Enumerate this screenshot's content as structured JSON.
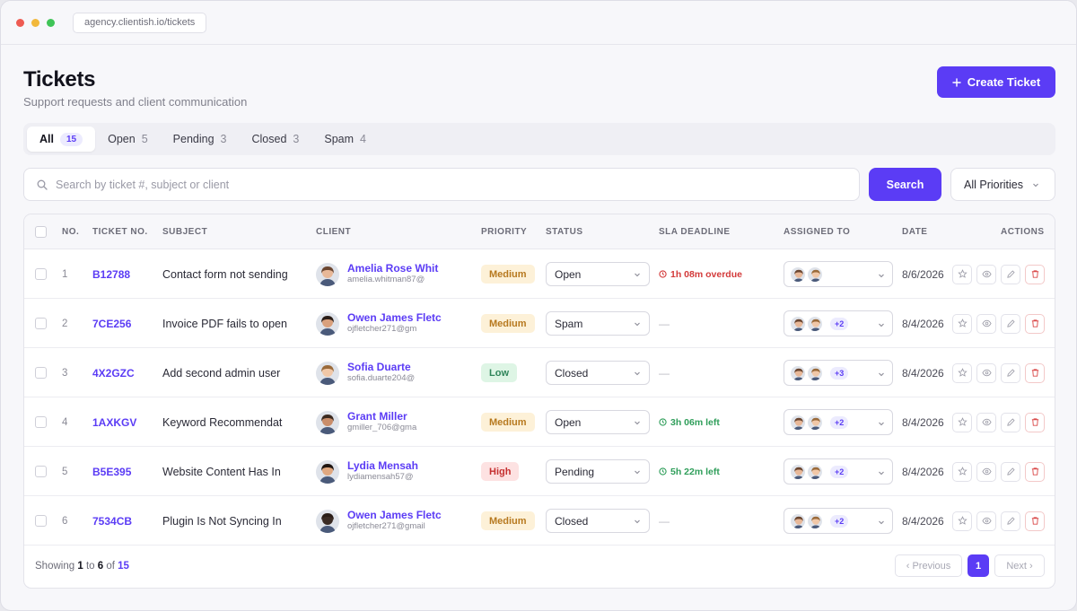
{
  "browser": {
    "url": "agency.clientish.io/tickets"
  },
  "header": {
    "title": "Tickets",
    "subtitle": "Support requests and client communication",
    "create_label": "Create Ticket"
  },
  "tabs": [
    {
      "label": "All",
      "count": "15",
      "active": true
    },
    {
      "label": "Open",
      "count": "5"
    },
    {
      "label": "Pending",
      "count": "3"
    },
    {
      "label": "Closed",
      "count": "3"
    },
    {
      "label": "Spam",
      "count": "4"
    }
  ],
  "search": {
    "placeholder": "Search by ticket #, subject or client",
    "value": "",
    "button_label": "Search",
    "priority_filter": "All Priorities"
  },
  "table": {
    "columns": {
      "no": "NO.",
      "ticket": "TICKET NO.",
      "subject": "SUBJECT",
      "client": "CLIENT",
      "priority": "PRIORITY",
      "status": "STATUS",
      "sla": "SLA DEADLINE",
      "assigned": "ASSIGNED TO",
      "date": "DATE",
      "actions": "ACTIONS"
    },
    "rows": [
      {
        "no": "1",
        "ticket": "B12788",
        "subject": "Contact form not sending",
        "client_name": "Amelia Rose Whit",
        "client_email": "amelia.whitman87@",
        "priority": "Medium",
        "status": "Open",
        "sla": "1h 08m overdue",
        "sla_state": "overdue",
        "assigned_extra": "",
        "date": "8/6/2026"
      },
      {
        "no": "2",
        "ticket": "7CE256",
        "subject": "Invoice PDF fails to open",
        "client_name": "Owen James Fletc",
        "client_email": "ojfletcher271@gm",
        "priority": "Medium",
        "status": "Spam",
        "sla": "—",
        "sla_state": "none",
        "assigned_extra": "+2",
        "date": "8/4/2026"
      },
      {
        "no": "3",
        "ticket": "4X2GZC",
        "subject": "Add second admin user",
        "client_name": "Sofia Duarte",
        "client_email": "sofia.duarte204@",
        "priority": "Low",
        "status": "Closed",
        "sla": "—",
        "sla_state": "none",
        "assigned_extra": "+3",
        "date": "8/4/2026"
      },
      {
        "no": "4",
        "ticket": "1AXKGV",
        "subject": "Keyword Recommendat",
        "client_name": "Grant Miller",
        "client_email": "gmiller_706@gma",
        "priority": "Medium",
        "status": "Open",
        "sla": "3h 06m left",
        "sla_state": "ok",
        "assigned_extra": "+2",
        "date": "8/4/2026"
      },
      {
        "no": "5",
        "ticket": "B5E395",
        "subject": "Website Content Has In",
        "client_name": "Lydia Mensah",
        "client_email": "lydiamensah57@",
        "priority": "High",
        "status": "Pending",
        "sla": "5h 22m left",
        "sla_state": "ok",
        "assigned_extra": "+2",
        "date": "8/4/2026"
      },
      {
        "no": "6",
        "ticket": "7534CB",
        "subject": "Plugin Is Not Syncing In",
        "client_name": "Owen James Fletc",
        "client_email": "ojfletcher271@gmail",
        "priority": "Medium",
        "status": "Closed",
        "sla": "—",
        "sla_state": "none",
        "assigned_extra": "+2",
        "date": "8/4/2026"
      }
    ]
  },
  "footer": {
    "showing_prefix": "Showing",
    "from": "1",
    "to_word": "to",
    "to": "6",
    "of_word": "of",
    "total": "15",
    "prev_label": "‹ Previous",
    "next_label": "Next ›",
    "current_page": "1"
  },
  "colors": {
    "accent": "#5b3cf5",
    "medium_bg": "#fdf1d8",
    "medium_fg": "#b7791f",
    "low_bg": "#def5e5",
    "low_fg": "#2f855a",
    "high_bg": "#fde2e2",
    "high_fg": "#c53030",
    "overdue": "#d33a3a",
    "ok": "#2f9e5a"
  },
  "icons": [
    "search-icon",
    "plus-icon",
    "chevron-down-icon",
    "clock-icon",
    "star-icon",
    "eye-icon",
    "edit-icon",
    "trash-icon"
  ]
}
